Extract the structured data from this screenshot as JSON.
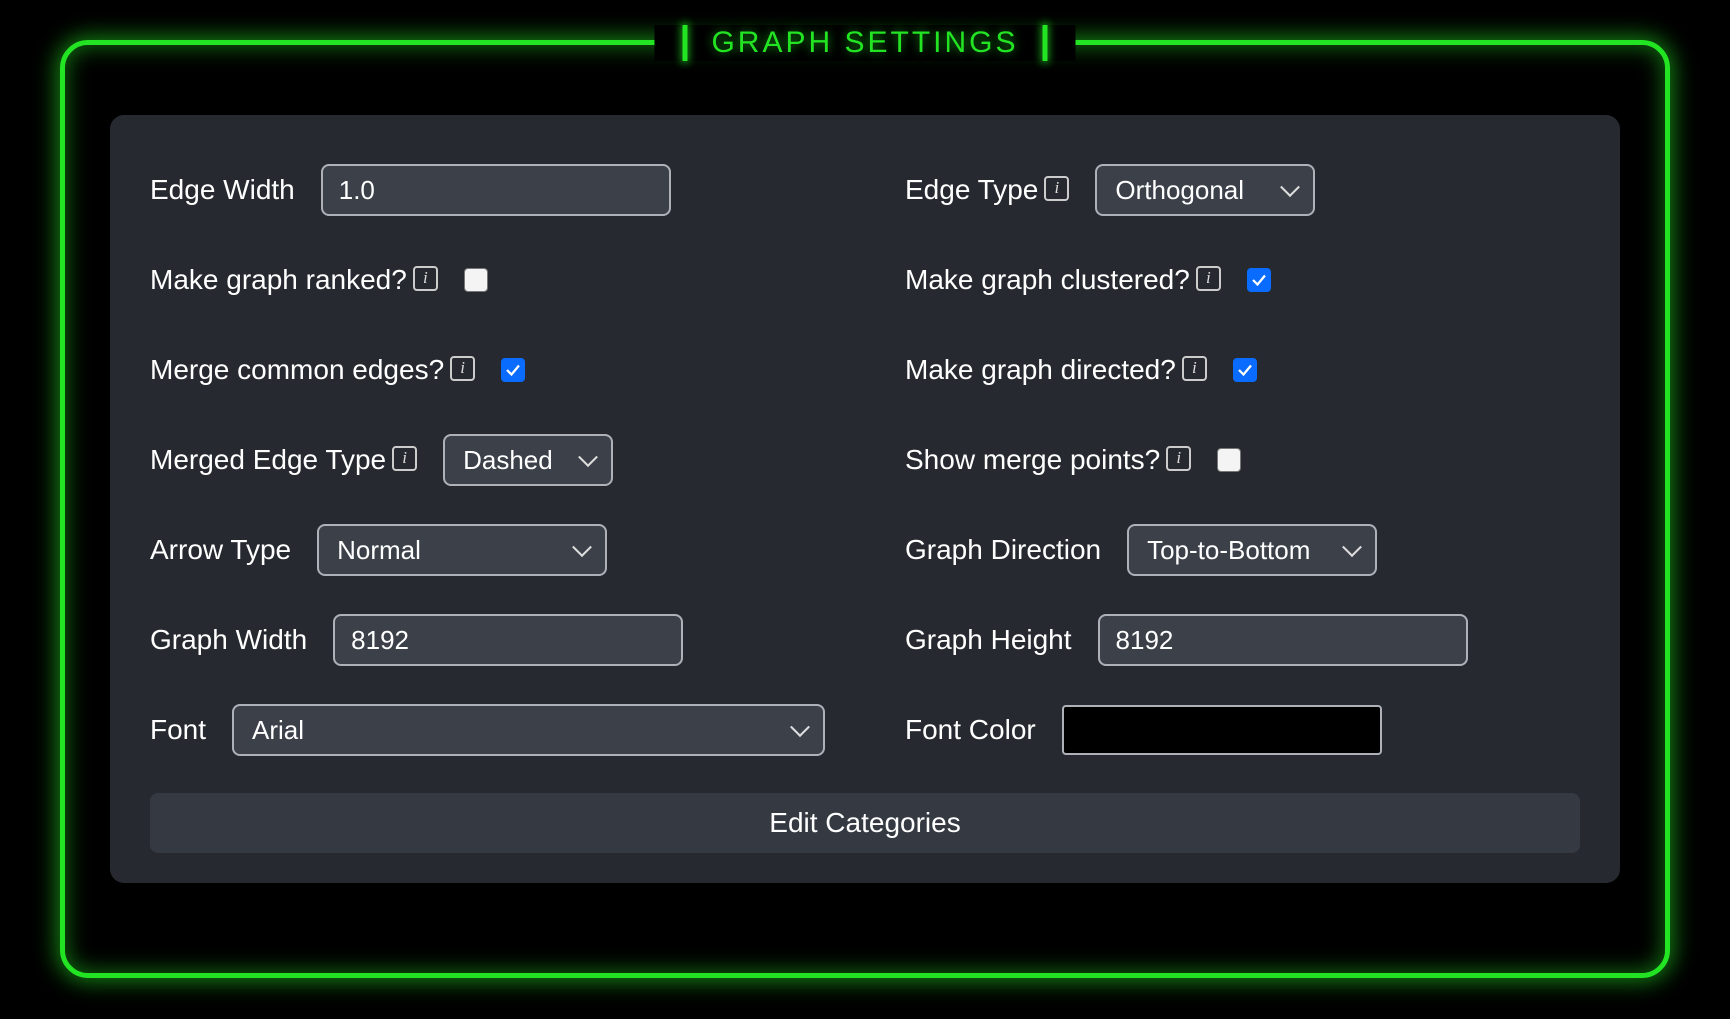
{
  "title": "GRAPH SETTINGS",
  "left": {
    "edge_width": {
      "label": "Edge Width",
      "value": "1.0"
    },
    "ranked": {
      "label": "Make graph ranked?",
      "checked": false
    },
    "merge": {
      "label": "Merge common edges?",
      "checked": true
    },
    "merged_edge_type": {
      "label": "Merged Edge Type",
      "value": "Dashed"
    },
    "arrow_type": {
      "label": "Arrow Type",
      "value": "Normal"
    },
    "graph_width": {
      "label": "Graph Width",
      "value": "8192"
    },
    "font": {
      "label": "Font",
      "value": "Arial"
    }
  },
  "right": {
    "edge_type": {
      "label": "Edge Type",
      "value": "Orthogonal"
    },
    "clustered": {
      "label": "Make graph clustered?",
      "checked": true
    },
    "directed": {
      "label": "Make graph directed?",
      "checked": true
    },
    "show_merge": {
      "label": "Show merge points?",
      "checked": false
    },
    "direction": {
      "label": "Graph Direction",
      "value": "Top-to-Bottom"
    },
    "graph_height": {
      "label": "Graph Height",
      "value": "8192"
    },
    "font_color": {
      "label": "Font Color",
      "value": "#000000"
    }
  },
  "edit_categories": "Edit Categories",
  "info_glyph": "i"
}
